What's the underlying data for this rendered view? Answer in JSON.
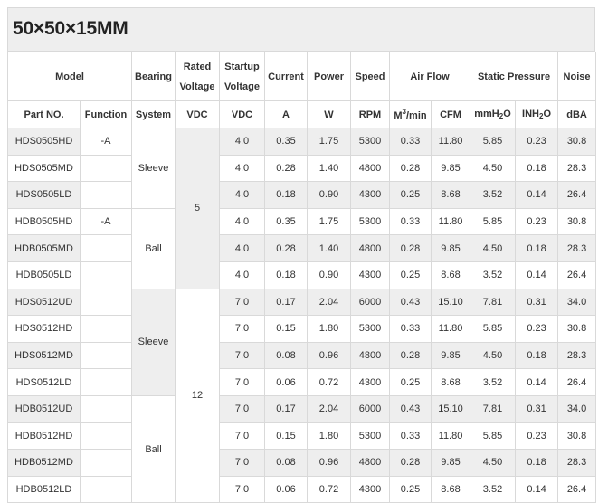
{
  "title": "50×50×15MM",
  "header": {
    "row1": {
      "model": "Model",
      "bearing": "Bearing",
      "rated_voltage": "Rated Voltage",
      "startup_voltage": "Startup Voltage",
      "current": "Current",
      "power": "Power",
      "speed": "Speed",
      "air_flow": "Air Flow",
      "static_pressure": "Static Pressure",
      "noise": "Noise"
    },
    "row2": {
      "part_no": "Part NO.",
      "function": "Function",
      "system": "System",
      "vdc1": "VDC",
      "vdc2": "VDC",
      "a": "A",
      "w": "W",
      "rpm": "RPM",
      "m3_base": "M",
      "m3_sup": "3",
      "m3_tail": "/min",
      "cfm": "CFM",
      "mmh_base": "mmH",
      "mmh_sub": "2",
      "mmh_tail": "O",
      "inh_base": "INH",
      "inh_sub": "2",
      "inh_tail": "O",
      "dba": "dBA"
    }
  },
  "groups": {
    "func_neg_a_1": "-A",
    "func_neg_a_2": "-A",
    "sleeve_1": "Sleeve",
    "ball_1": "Ball",
    "sleeve_2": "Sleeve",
    "ball_2": "Ball",
    "rated_5": "5",
    "rated_12": "12"
  },
  "rows": [
    {
      "part": "HDS0505HD",
      "startup": "4.0",
      "current": "0.35",
      "power": "1.75",
      "rpm": "5300",
      "m3": "0.33",
      "cfm": "11.80",
      "mmh2o": "5.85",
      "inh2o": "0.23",
      "dba": "30.8"
    },
    {
      "part": "HDS0505MD",
      "startup": "4.0",
      "current": "0.28",
      "power": "1.40",
      "rpm": "4800",
      "m3": "0.28",
      "cfm": "9.85",
      "mmh2o": "4.50",
      "inh2o": "0.18",
      "dba": "28.3"
    },
    {
      "part": "HDS0505LD",
      "startup": "4.0",
      "current": "0.18",
      "power": "0.90",
      "rpm": "4300",
      "m3": "0.25",
      "cfm": "8.68",
      "mmh2o": "3.52",
      "inh2o": "0.14",
      "dba": "26.4"
    },
    {
      "part": "HDB0505HD",
      "startup": "4.0",
      "current": "0.35",
      "power": "1.75",
      "rpm": "5300",
      "m3": "0.33",
      "cfm": "11.80",
      "mmh2o": "5.85",
      "inh2o": "0.23",
      "dba": "30.8"
    },
    {
      "part": "HDB0505MD",
      "startup": "4.0",
      "current": "0.28",
      "power": "1.40",
      "rpm": "4800",
      "m3": "0.28",
      "cfm": "9.85",
      "mmh2o": "4.50",
      "inh2o": "0.18",
      "dba": "28.3"
    },
    {
      "part": "HDB0505LD",
      "startup": "4.0",
      "current": "0.18",
      "power": "0.90",
      "rpm": "4300",
      "m3": "0.25",
      "cfm": "8.68",
      "mmh2o": "3.52",
      "inh2o": "0.14",
      "dba": "26.4"
    },
    {
      "part": "HDS0512UD",
      "startup": "7.0",
      "current": "0.17",
      "power": "2.04",
      "rpm": "6000",
      "m3": "0.43",
      "cfm": "15.10",
      "mmh2o": "7.81",
      "inh2o": "0.31",
      "dba": "34.0"
    },
    {
      "part": "HDS0512HD",
      "startup": "7.0",
      "current": "0.15",
      "power": "1.80",
      "rpm": "5300",
      "m3": "0.33",
      "cfm": "11.80",
      "mmh2o": "5.85",
      "inh2o": "0.23",
      "dba": "30.8"
    },
    {
      "part": "HDS0512MD",
      "startup": "7.0",
      "current": "0.08",
      "power": "0.96",
      "rpm": "4800",
      "m3": "0.28",
      "cfm": "9.85",
      "mmh2o": "4.50",
      "inh2o": "0.18",
      "dba": "28.3"
    },
    {
      "part": "HDS0512LD",
      "startup": "7.0",
      "current": "0.06",
      "power": "0.72",
      "rpm": "4300",
      "m3": "0.25",
      "cfm": "8.68",
      "mmh2o": "3.52",
      "inh2o": "0.14",
      "dba": "26.4"
    },
    {
      "part": "HDB0512UD",
      "startup": "7.0",
      "current": "0.17",
      "power": "2.04",
      "rpm": "6000",
      "m3": "0.43",
      "cfm": "15.10",
      "mmh2o": "7.81",
      "inh2o": "0.31",
      "dba": "34.0"
    },
    {
      "part": "HDB0512HD",
      "startup": "7.0",
      "current": "0.15",
      "power": "1.80",
      "rpm": "5300",
      "m3": "0.33",
      "cfm": "11.80",
      "mmh2o": "5.85",
      "inh2o": "0.23",
      "dba": "30.8"
    },
    {
      "part": "HDB0512MD",
      "startup": "7.0",
      "current": "0.08",
      "power": "0.96",
      "rpm": "4800",
      "m3": "0.28",
      "cfm": "9.85",
      "mmh2o": "4.50",
      "inh2o": "0.18",
      "dba": "28.3"
    },
    {
      "part": "HDB0512LD",
      "startup": "7.0",
      "current": "0.06",
      "power": "0.72",
      "rpm": "4300",
      "m3": "0.25",
      "cfm": "8.68",
      "mmh2o": "3.52",
      "inh2o": "0.14",
      "dba": "26.4"
    }
  ]
}
